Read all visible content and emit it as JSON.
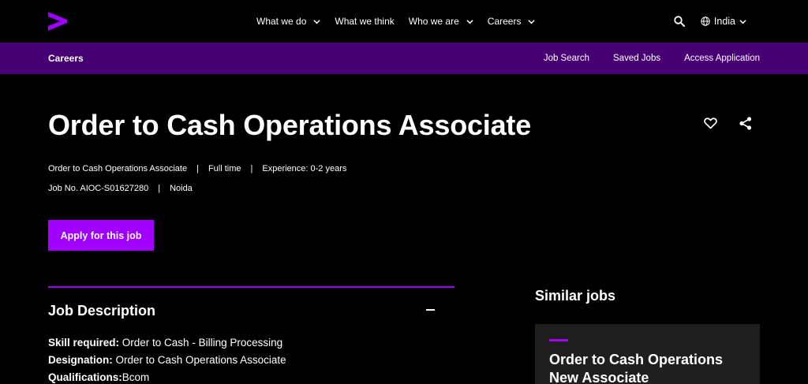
{
  "topnav": {
    "items": [
      {
        "label": "What we do",
        "has_dropdown": true
      },
      {
        "label": "What we think",
        "has_dropdown": false
      },
      {
        "label": "Who we are",
        "has_dropdown": true
      },
      {
        "label": "Careers",
        "has_dropdown": true
      }
    ],
    "locale": "India"
  },
  "subnav": {
    "brand": "Careers",
    "links": [
      "Job Search",
      "Saved Jobs",
      "Access Application"
    ]
  },
  "job": {
    "title": "Order to Cash Operations Associate",
    "role": "Order to Cash Operations Associate",
    "type": "Full time",
    "experience": "Experience: 0-2 years",
    "job_no": "Job No. AIOC-S01627280",
    "location": "Noida",
    "apply_label": "Apply for this job"
  },
  "description": {
    "heading": "Job Description",
    "skill_label": "Skill required:",
    "skill_value": " Order to Cash - Billing Processing",
    "designation_label": "Designation:",
    "designation_value": " Order to Cash Operations Associate",
    "qualifications_label": "Qualifications:",
    "qualifications_value": "Bcom"
  },
  "similar": {
    "heading": "Similar jobs",
    "cards": [
      {
        "title": "Order to Cash Operations New Associate"
      }
    ]
  },
  "colors": {
    "accent": "#a100ff",
    "subnav_bg": "#460073",
    "background": "#000000",
    "card_bg": "#1f1f1f"
  },
  "icons": [
    "accenture-logo-icon",
    "chevron-down-icon",
    "search-icon",
    "globe-icon",
    "heart-icon",
    "share-icon",
    "minus-icon"
  ]
}
